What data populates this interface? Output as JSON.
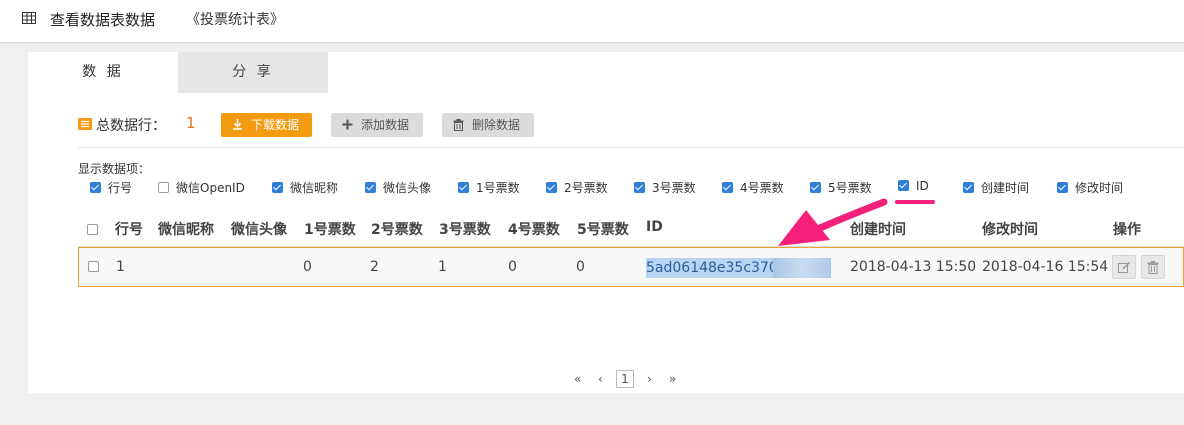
{
  "header": {
    "title": "查看数据表数据",
    "table_name": "《投票统计表》"
  },
  "tabs": [
    {
      "label": "数 据",
      "active": true
    },
    {
      "label": "分 享",
      "active": false
    }
  ],
  "toolbar": {
    "total_label": "总数据行：",
    "total_count": "1",
    "download_label": "下载数据",
    "add_label": "添加数据",
    "delete_label": "删除数据"
  },
  "column_selector": {
    "title": "显示数据项：",
    "options": [
      {
        "label": "行号",
        "checked": true
      },
      {
        "label": "微信OpenID",
        "checked": false
      },
      {
        "label": "微信昵称",
        "checked": true
      },
      {
        "label": "微信头像",
        "checked": true
      },
      {
        "label": "1号票数",
        "checked": true
      },
      {
        "label": "2号票数",
        "checked": true
      },
      {
        "label": "3号票数",
        "checked": true
      },
      {
        "label": "4号票数",
        "checked": true
      },
      {
        "label": "5号票数",
        "checked": true
      },
      {
        "label": "ID",
        "checked": true
      },
      {
        "label": "创建时间",
        "checked": true
      },
      {
        "label": "修改时间",
        "checked": true
      }
    ]
  },
  "table": {
    "headers": [
      "行号",
      "微信昵称",
      "微信头像",
      "1号票数",
      "2号票数",
      "3号票数",
      "4号票数",
      "5号票数",
      "ID",
      "创建时间",
      "修改时间",
      "操作"
    ],
    "rows": [
      {
        "row_no": "1",
        "nickname": "",
        "avatar": "",
        "v1": "0",
        "v2": "2",
        "v3": "1",
        "v4": "0",
        "v5": "0",
        "id": "5ad06148e35c3700",
        "created": "2018-04-13 15:50",
        "modified": "2018-04-16 15:54"
      }
    ]
  },
  "pagination": {
    "first": "«",
    "prev": "‹",
    "current": "1",
    "next": "›",
    "last": "»"
  },
  "colors": {
    "accent_orange": "#f39c12",
    "count_orange": "#e8761a",
    "checkbox_blue": "#2f7fd8",
    "annotation_pink": "#f5207a",
    "row_border": "#e8a23a"
  }
}
